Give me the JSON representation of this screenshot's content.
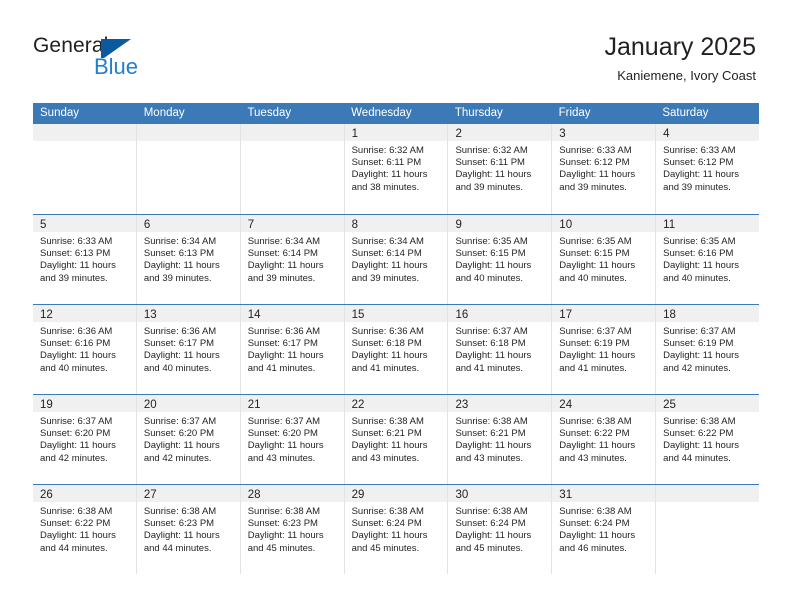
{
  "brand": {
    "name_top": "General",
    "name_bottom": "Blue",
    "flag_icon": "blue-flag-triangle-icon",
    "accent_color": "#1f7fd0",
    "flag_color": "#0b5a9e"
  },
  "header": {
    "title": "January 2025",
    "subtitle": "Kaniemene, Ivory Coast"
  },
  "theme": {
    "header_blue": "#3b79b7",
    "daynum_band": "#f0f0f0",
    "cell_border": "#e2e3e4",
    "text": "#231f20"
  },
  "calendar": {
    "day_headers": [
      "Sunday",
      "Monday",
      "Tuesday",
      "Wednesday",
      "Thursday",
      "Friday",
      "Saturday"
    ],
    "weeks": [
      [
        {
          "day": "",
          "sunrise": "",
          "sunset": "",
          "daylight_l1": "",
          "daylight_l2": "",
          "empty": true
        },
        {
          "day": "",
          "sunrise": "",
          "sunset": "",
          "daylight_l1": "",
          "daylight_l2": "",
          "empty": true
        },
        {
          "day": "",
          "sunrise": "",
          "sunset": "",
          "daylight_l1": "",
          "daylight_l2": "",
          "empty": true
        },
        {
          "day": "1",
          "sunrise": "Sunrise: 6:32 AM",
          "sunset": "Sunset: 6:11 PM",
          "daylight_l1": "Daylight: 11 hours",
          "daylight_l2": "and 38 minutes."
        },
        {
          "day": "2",
          "sunrise": "Sunrise: 6:32 AM",
          "sunset": "Sunset: 6:11 PM",
          "daylight_l1": "Daylight: 11 hours",
          "daylight_l2": "and 39 minutes."
        },
        {
          "day": "3",
          "sunrise": "Sunrise: 6:33 AM",
          "sunset": "Sunset: 6:12 PM",
          "daylight_l1": "Daylight: 11 hours",
          "daylight_l2": "and 39 minutes."
        },
        {
          "day": "4",
          "sunrise": "Sunrise: 6:33 AM",
          "sunset": "Sunset: 6:12 PM",
          "daylight_l1": "Daylight: 11 hours",
          "daylight_l2": "and 39 minutes."
        }
      ],
      [
        {
          "day": "5",
          "sunrise": "Sunrise: 6:33 AM",
          "sunset": "Sunset: 6:13 PM",
          "daylight_l1": "Daylight: 11 hours",
          "daylight_l2": "and 39 minutes."
        },
        {
          "day": "6",
          "sunrise": "Sunrise: 6:34 AM",
          "sunset": "Sunset: 6:13 PM",
          "daylight_l1": "Daylight: 11 hours",
          "daylight_l2": "and 39 minutes."
        },
        {
          "day": "7",
          "sunrise": "Sunrise: 6:34 AM",
          "sunset": "Sunset: 6:14 PM",
          "daylight_l1": "Daylight: 11 hours",
          "daylight_l2": "and 39 minutes."
        },
        {
          "day": "8",
          "sunrise": "Sunrise: 6:34 AM",
          "sunset": "Sunset: 6:14 PM",
          "daylight_l1": "Daylight: 11 hours",
          "daylight_l2": "and 39 minutes."
        },
        {
          "day": "9",
          "sunrise": "Sunrise: 6:35 AM",
          "sunset": "Sunset: 6:15 PM",
          "daylight_l1": "Daylight: 11 hours",
          "daylight_l2": "and 40 minutes."
        },
        {
          "day": "10",
          "sunrise": "Sunrise: 6:35 AM",
          "sunset": "Sunset: 6:15 PM",
          "daylight_l1": "Daylight: 11 hours",
          "daylight_l2": "and 40 minutes."
        },
        {
          "day": "11",
          "sunrise": "Sunrise: 6:35 AM",
          "sunset": "Sunset: 6:16 PM",
          "daylight_l1": "Daylight: 11 hours",
          "daylight_l2": "and 40 minutes."
        }
      ],
      [
        {
          "day": "12",
          "sunrise": "Sunrise: 6:36 AM",
          "sunset": "Sunset: 6:16 PM",
          "daylight_l1": "Daylight: 11 hours",
          "daylight_l2": "and 40 minutes."
        },
        {
          "day": "13",
          "sunrise": "Sunrise: 6:36 AM",
          "sunset": "Sunset: 6:17 PM",
          "daylight_l1": "Daylight: 11 hours",
          "daylight_l2": "and 40 minutes."
        },
        {
          "day": "14",
          "sunrise": "Sunrise: 6:36 AM",
          "sunset": "Sunset: 6:17 PM",
          "daylight_l1": "Daylight: 11 hours",
          "daylight_l2": "and 41 minutes."
        },
        {
          "day": "15",
          "sunrise": "Sunrise: 6:36 AM",
          "sunset": "Sunset: 6:18 PM",
          "daylight_l1": "Daylight: 11 hours",
          "daylight_l2": "and 41 minutes."
        },
        {
          "day": "16",
          "sunrise": "Sunrise: 6:37 AM",
          "sunset": "Sunset: 6:18 PM",
          "daylight_l1": "Daylight: 11 hours",
          "daylight_l2": "and 41 minutes."
        },
        {
          "day": "17",
          "sunrise": "Sunrise: 6:37 AM",
          "sunset": "Sunset: 6:19 PM",
          "daylight_l1": "Daylight: 11 hours",
          "daylight_l2": "and 41 minutes."
        },
        {
          "day": "18",
          "sunrise": "Sunrise: 6:37 AM",
          "sunset": "Sunset: 6:19 PM",
          "daylight_l1": "Daylight: 11 hours",
          "daylight_l2": "and 42 minutes."
        }
      ],
      [
        {
          "day": "19",
          "sunrise": "Sunrise: 6:37 AM",
          "sunset": "Sunset: 6:20 PM",
          "daylight_l1": "Daylight: 11 hours",
          "daylight_l2": "and 42 minutes."
        },
        {
          "day": "20",
          "sunrise": "Sunrise: 6:37 AM",
          "sunset": "Sunset: 6:20 PM",
          "daylight_l1": "Daylight: 11 hours",
          "daylight_l2": "and 42 minutes."
        },
        {
          "day": "21",
          "sunrise": "Sunrise: 6:37 AM",
          "sunset": "Sunset: 6:20 PM",
          "daylight_l1": "Daylight: 11 hours",
          "daylight_l2": "and 43 minutes."
        },
        {
          "day": "22",
          "sunrise": "Sunrise: 6:38 AM",
          "sunset": "Sunset: 6:21 PM",
          "daylight_l1": "Daylight: 11 hours",
          "daylight_l2": "and 43 minutes."
        },
        {
          "day": "23",
          "sunrise": "Sunrise: 6:38 AM",
          "sunset": "Sunset: 6:21 PM",
          "daylight_l1": "Daylight: 11 hours",
          "daylight_l2": "and 43 minutes."
        },
        {
          "day": "24",
          "sunrise": "Sunrise: 6:38 AM",
          "sunset": "Sunset: 6:22 PM",
          "daylight_l1": "Daylight: 11 hours",
          "daylight_l2": "and 43 minutes."
        },
        {
          "day": "25",
          "sunrise": "Sunrise: 6:38 AM",
          "sunset": "Sunset: 6:22 PM",
          "daylight_l1": "Daylight: 11 hours",
          "daylight_l2": "and 44 minutes."
        }
      ],
      [
        {
          "day": "26",
          "sunrise": "Sunrise: 6:38 AM",
          "sunset": "Sunset: 6:22 PM",
          "daylight_l1": "Daylight: 11 hours",
          "daylight_l2": "and 44 minutes."
        },
        {
          "day": "27",
          "sunrise": "Sunrise: 6:38 AM",
          "sunset": "Sunset: 6:23 PM",
          "daylight_l1": "Daylight: 11 hours",
          "daylight_l2": "and 44 minutes."
        },
        {
          "day": "28",
          "sunrise": "Sunrise: 6:38 AM",
          "sunset": "Sunset: 6:23 PM",
          "daylight_l1": "Daylight: 11 hours",
          "daylight_l2": "and 45 minutes."
        },
        {
          "day": "29",
          "sunrise": "Sunrise: 6:38 AM",
          "sunset": "Sunset: 6:24 PM",
          "daylight_l1": "Daylight: 11 hours",
          "daylight_l2": "and 45 minutes."
        },
        {
          "day": "30",
          "sunrise": "Sunrise: 6:38 AM",
          "sunset": "Sunset: 6:24 PM",
          "daylight_l1": "Daylight: 11 hours",
          "daylight_l2": "and 45 minutes."
        },
        {
          "day": "31",
          "sunrise": "Sunrise: 6:38 AM",
          "sunset": "Sunset: 6:24 PM",
          "daylight_l1": "Daylight: 11 hours",
          "daylight_l2": "and 46 minutes."
        },
        {
          "day": "",
          "sunrise": "",
          "sunset": "",
          "daylight_l1": "",
          "daylight_l2": "",
          "empty": true
        }
      ]
    ]
  }
}
